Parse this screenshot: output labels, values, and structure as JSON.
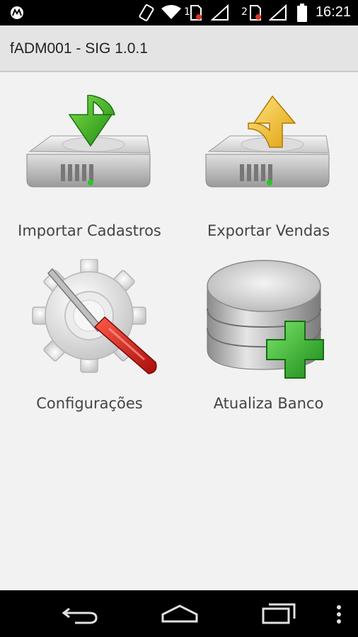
{
  "status_bar": {
    "time": "16:21",
    "sim1_label": "1",
    "sim2_label": "2",
    "icons": [
      "motorola-logo-icon",
      "screen-rotation-icon",
      "wifi-icon",
      "sim-1-icon",
      "signal-1-icon",
      "sim-2-icon",
      "signal-2-icon",
      "battery-icon"
    ]
  },
  "app_bar": {
    "title": "fADM001 - SIG 1.0.1"
  },
  "menu": {
    "items": [
      {
        "label": "Importar Cadastros",
        "icon": "import-drive-icon"
      },
      {
        "label": "Exportar Vendas",
        "icon": "export-drive-icon"
      },
      {
        "label": "Configurações",
        "icon": "settings-gear-screwdriver-icon"
      },
      {
        "label": "Atualiza Banco",
        "icon": "database-add-icon"
      }
    ]
  },
  "nav_bar": {
    "icons": [
      "back-icon",
      "home-icon",
      "recents-icon",
      "overflow-menu-icon"
    ]
  },
  "colors": {
    "status_bar": "#000000",
    "app_bar": "#e4e4e4",
    "background": "#f2f2f2",
    "text": "#444444"
  }
}
